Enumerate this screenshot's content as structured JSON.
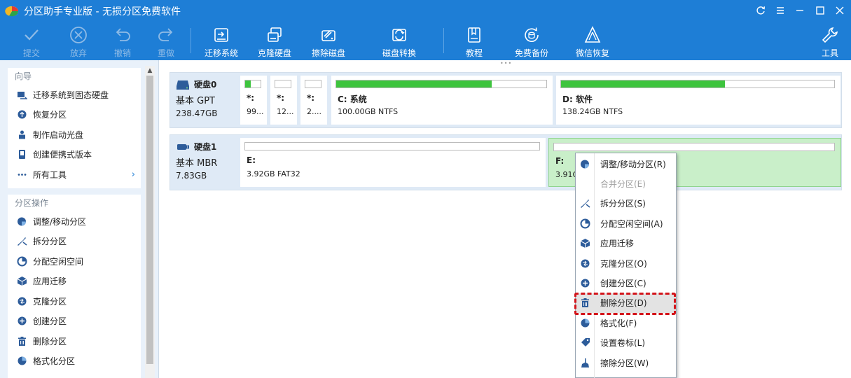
{
  "window": {
    "title": "分区助手专业版 - 无损分区免费软件",
    "colors": {
      "accent": "#1e7ed6",
      "used_bar": "#3dc43d",
      "selected_partition": "#c9efc9",
      "highlight": "#d3141a"
    }
  },
  "toolbar": {
    "commit": "提交",
    "discard": "放弃",
    "undo": "撤销",
    "redo": "重做",
    "migrate_os": "迁移系统",
    "clone_disk": "克隆硬盘",
    "wipe_disk": "擦除磁盘",
    "disk_convert": "磁盘转换",
    "tutorial": "教程",
    "free_backup": "免费备份",
    "wechat_recovery": "微信恢复",
    "tools": "工具"
  },
  "sidebar": {
    "wizard_title": "向导",
    "wizard_items": [
      {
        "label": "迁移系统到固态硬盘",
        "icon": "migrate-icon"
      },
      {
        "label": "恢复分区",
        "icon": "recover-icon"
      },
      {
        "label": "制作启动光盘",
        "icon": "bootdisk-icon"
      },
      {
        "label": "创建便携式版本",
        "icon": "portable-icon"
      },
      {
        "label": "所有工具",
        "icon": "more-icon"
      }
    ],
    "partition_title": "分区操作",
    "partition_items": [
      {
        "label": "调整/移动分区",
        "icon": "resize-icon"
      },
      {
        "label": "拆分分区",
        "icon": "split-icon"
      },
      {
        "label": "分配空闲空间",
        "icon": "allocate-icon"
      },
      {
        "label": "应用迁移",
        "icon": "app-move-icon"
      },
      {
        "label": "克隆分区",
        "icon": "clone-icon"
      },
      {
        "label": "创建分区",
        "icon": "create-icon"
      },
      {
        "label": "删除分区",
        "icon": "delete-icon"
      },
      {
        "label": "格式化分区",
        "icon": "format-icon"
      }
    ]
  },
  "disks": [
    {
      "name": "硬盘0",
      "type": "基本 GPT",
      "size": "238.47GB",
      "partitions": [
        {
          "name": "*:",
          "info": "99...",
          "used_fraction": 0.35
        },
        {
          "name": "*:",
          "info": "12...",
          "used_fraction": 0.0
        },
        {
          "name": "*:",
          "info": "2....",
          "used_fraction": 0.0
        },
        {
          "name": "C: 系统",
          "info": "100.00GB NTFS",
          "used_fraction": 0.74
        },
        {
          "name": "D: 软件",
          "info": "138.24GB NTFS",
          "used_fraction": 0.6
        }
      ]
    },
    {
      "name": "硬盘1",
      "type": "基本 MBR",
      "size": "7.83GB",
      "partitions": [
        {
          "name": "E:",
          "info": "3.92GB FAT32",
          "used_fraction": 0.0
        },
        {
          "name": "F:",
          "info": "3.91GB",
          "used_fraction": 0.0
        }
      ]
    }
  ],
  "context_menu": {
    "items": [
      {
        "label": "调整/移动分区(R)",
        "icon": "resize-icon",
        "enabled": true
      },
      {
        "label": "合并分区(E)",
        "icon": "merge-icon",
        "enabled": false
      },
      {
        "label": "拆分分区(S)",
        "icon": "split-icon",
        "enabled": true
      },
      {
        "label": "分配空闲空间(A)",
        "icon": "allocate-icon",
        "enabled": true
      },
      {
        "label": "应用迁移",
        "icon": "app-move-icon",
        "enabled": true
      },
      {
        "label": "克隆分区(O)",
        "icon": "clone-icon",
        "enabled": true
      },
      {
        "label": "创建分区(C)",
        "icon": "create-icon",
        "enabled": true
      },
      {
        "label": "删除分区(D)",
        "icon": "delete-icon",
        "enabled": true
      },
      {
        "label": "格式化(F)",
        "icon": "format-icon",
        "enabled": true
      },
      {
        "label": "设置卷标(L)",
        "icon": "label-icon",
        "enabled": true
      },
      {
        "label": "擦除分区(W)",
        "icon": "wipe-icon",
        "enabled": true
      }
    ]
  }
}
